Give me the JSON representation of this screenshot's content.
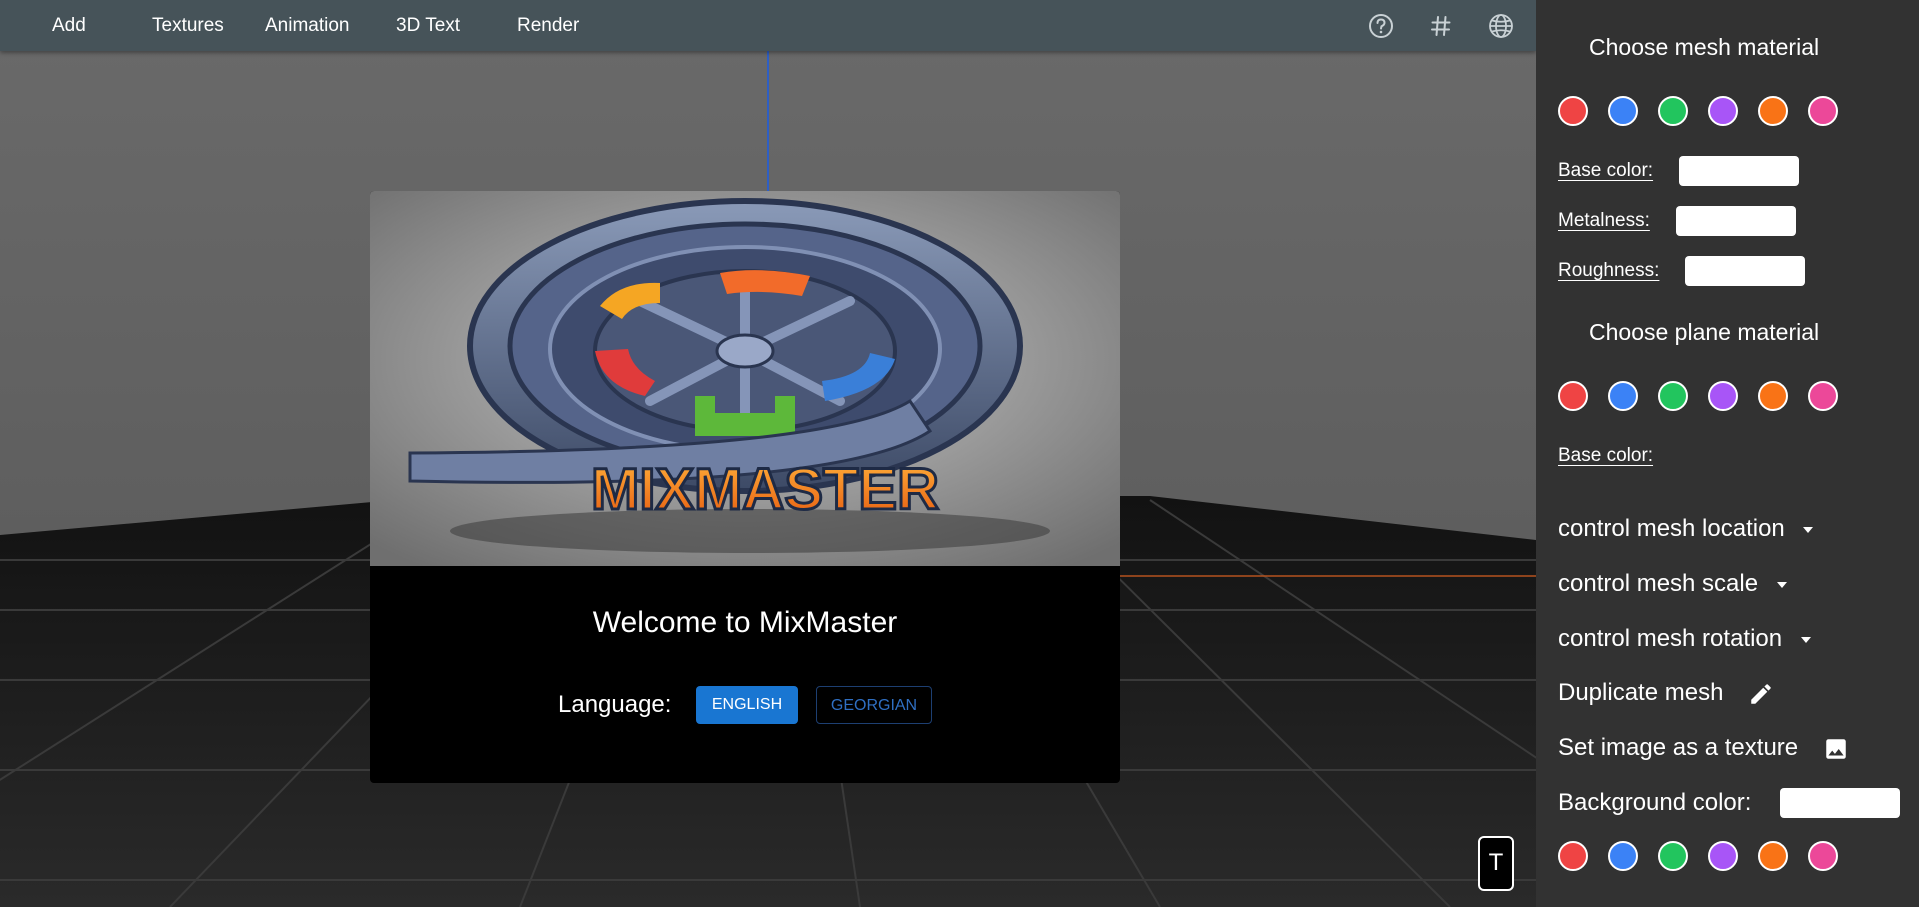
{
  "menu": {
    "items": [
      {
        "id": "add",
        "label": "Add"
      },
      {
        "id": "textures",
        "label": "Textures"
      },
      {
        "id": "animation",
        "label": "Animation"
      },
      {
        "id": "3d-text",
        "label": "3D Text"
      },
      {
        "id": "render",
        "label": "Render"
      }
    ],
    "icons": [
      "help-circle-icon",
      "grid-hash-icon",
      "globe-icon"
    ]
  },
  "dialog": {
    "logo_text": "MIXMASTER",
    "welcome": "Welcome to MixMaster",
    "language_label": "Language:",
    "languages": {
      "english": "ENGLISH",
      "georgian": "GEORGIAN"
    },
    "selected_language": "ENGLISH"
  },
  "t_button": "T",
  "panel": {
    "mesh_material": {
      "title": "Choose mesh material",
      "base_color_label": "Base color:",
      "metalness_label": "Metalness:",
      "roughness_label": "Roughness:",
      "base_color_value": "",
      "metalness_value": "",
      "roughness_value": ""
    },
    "plane_material": {
      "title": "Choose plane material",
      "base_color_label": "Base color:"
    },
    "controls": {
      "location": "control mesh location",
      "scale": "control mesh scale",
      "rotation": "control mesh rotation",
      "duplicate": "Duplicate mesh",
      "texture": "Set image as a texture",
      "background_label": "Background color:",
      "background_value": ""
    },
    "swatch_colors": [
      "#ef4444",
      "#3b82f6",
      "#22c55e",
      "#a855f7",
      "#f97316",
      "#ec4899"
    ]
  },
  "colors": {
    "topbar": "#465359",
    "panel": "#323232",
    "accent_blue": "#1976d2"
  }
}
